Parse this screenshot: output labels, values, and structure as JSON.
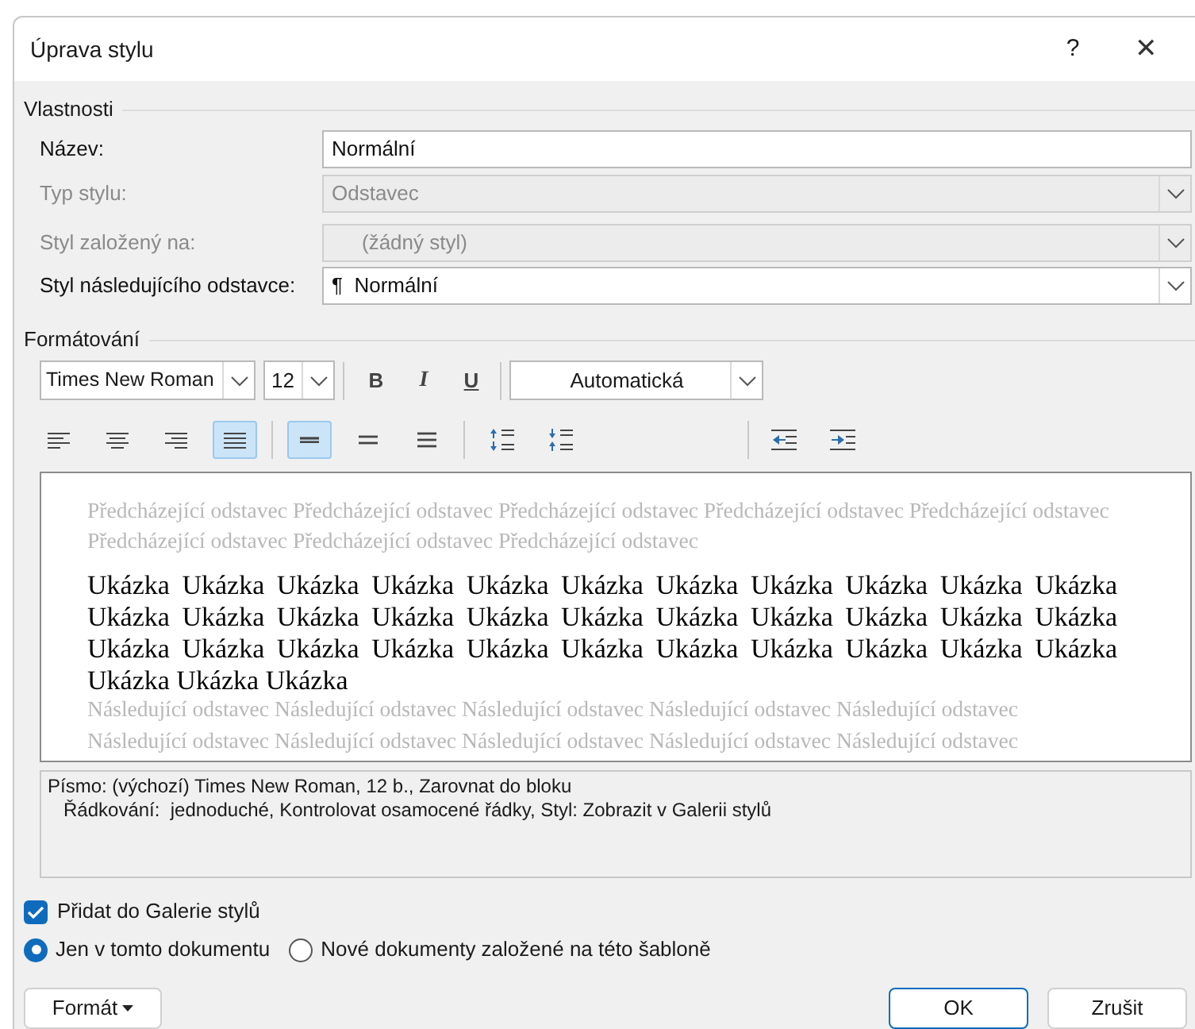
{
  "window": {
    "title": "Úprava stylu",
    "help": "?",
    "close": "✕"
  },
  "properties": {
    "legend": "Vlastnosti",
    "rows": [
      {
        "label": "Název:",
        "value": "Normální",
        "kind": "text",
        "disabled": false
      },
      {
        "label": "Typ stylu:",
        "value": "Odstavec",
        "kind": "combo",
        "disabled": true
      },
      {
        "label": "Styl založený na:",
        "value": "(žádný styl)",
        "kind": "combo",
        "disabled": true
      },
      {
        "label": "Styl následujícího odstavce:",
        "value": "Normální",
        "mark": "¶",
        "kind": "combo",
        "disabled": false
      }
    ]
  },
  "formatting": {
    "legend": "Formátování",
    "font": "Times New Roman",
    "size": "12",
    "bold": "B",
    "italic": "I",
    "underline": "U",
    "color_label": "Automatická",
    "tool_groups": [
      [
        {
          "kind": "align-left",
          "selected": false
        },
        {
          "kind": "align-center",
          "selected": false
        },
        {
          "kind": "align-right",
          "selected": false
        },
        {
          "kind": "align-justify",
          "selected": true
        }
      ],
      [
        {
          "kind": "spacing-single",
          "selected": true
        },
        {
          "kind": "spacing-half",
          "selected": false
        },
        {
          "kind": "spacing-double",
          "selected": false
        }
      ],
      [
        {
          "kind": "space-up",
          "selected": false
        },
        {
          "kind": "space-down",
          "selected": false
        }
      ],
      [
        {
          "kind": "indent-decrease",
          "selected": false
        },
        {
          "kind": "indent-increase",
          "selected": false
        }
      ]
    ]
  },
  "preview": {
    "previous": "Předcházející odstavec Předcházející odstavec Předcházející odstavec Předcházející odstavec Předcházející odstavec Předcházející odstavec Předcházející odstavec Předcházející odstavec",
    "sample": "Ukázka Ukázka Ukázka Ukázka Ukázka Ukázka Ukázka Ukázka Ukázka Ukázka Ukázka Ukázka Ukázka Ukázka Ukázka Ukázka Ukázka Ukázka Ukázka Ukázka Ukázka Ukázka Ukázka Ukázka Ukázka Ukázka Ukázka Ukázka Ukázka Ukázka Ukázka Ukázka Ukázka Ukázka Ukázka Ukázka",
    "following": "Následující odstavec Následující odstavec Následující odstavec Následující odstavec Následující odstavec Následující odstavec Následující odstavec Následující odstavec Následující odstavec Následující odstavec"
  },
  "description": [
    "Písmo: (výchozí) Times New Roman, 12 b., Zarovnat do bloku",
    "Řádkování:  jednoduché, Kontrolovat osamocené řádky, Styl: Zobrazit v Galerii stylů"
  ],
  "add_to_gallery": {
    "label": "Přidat do Galerie stylů",
    "checked": true
  },
  "scope": [
    {
      "label": "Jen v tomto dokumentu",
      "selected": true
    },
    {
      "label": "Nové dokumenty založené na této šabloně",
      "selected": false
    }
  ],
  "buttons": {
    "format": "Formát",
    "ok": "OK",
    "cancel": "Zrušit"
  }
}
